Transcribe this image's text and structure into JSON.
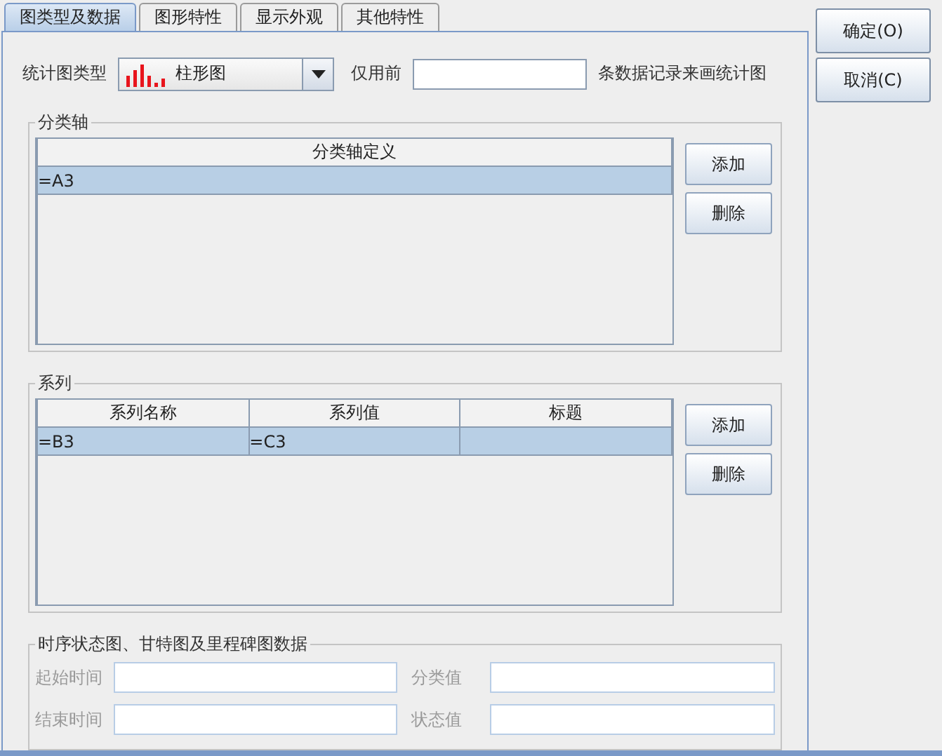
{
  "tabs": [
    {
      "label": "图类型及数据",
      "selected": true
    },
    {
      "label": "图形特性",
      "selected": false
    },
    {
      "label": "显示外观",
      "selected": false
    },
    {
      "label": "其他特性",
      "selected": false
    }
  ],
  "chart_type": {
    "label": "统计图类型",
    "value": "柱形图"
  },
  "limit": {
    "label": "仅用前",
    "suffix": "条数据记录来画统计图"
  },
  "category_axis": {
    "title": "分类轴",
    "columns": [
      "分类轴定义"
    ],
    "rows": [
      {
        "cells": [
          "=A3"
        ],
        "selected": true
      }
    ],
    "buttons": [
      "添加",
      "删除"
    ]
  },
  "series": {
    "title": "系列",
    "columns": [
      "系列名称",
      "系列值",
      "标题"
    ],
    "rows": [
      {
        "cells": [
          "=B3",
          "=C3"
        ],
        "selected": true
      }
    ],
    "buttons": [
      "添加",
      "删除"
    ]
  },
  "time_data": {
    "title": "时序状态图、甘特图及里程碑图数据",
    "fields": [
      {
        "label": "起始时间",
        "disabled": true
      },
      {
        "label": "分类值",
        "disabled": true
      },
      {
        "label": "结束时间",
        "disabled": true
      },
      {
        "label": "状态值",
        "disabled": true
      }
    ]
  },
  "dialog_buttons": [
    "确定(O)",
    "取消(C)"
  ]
}
